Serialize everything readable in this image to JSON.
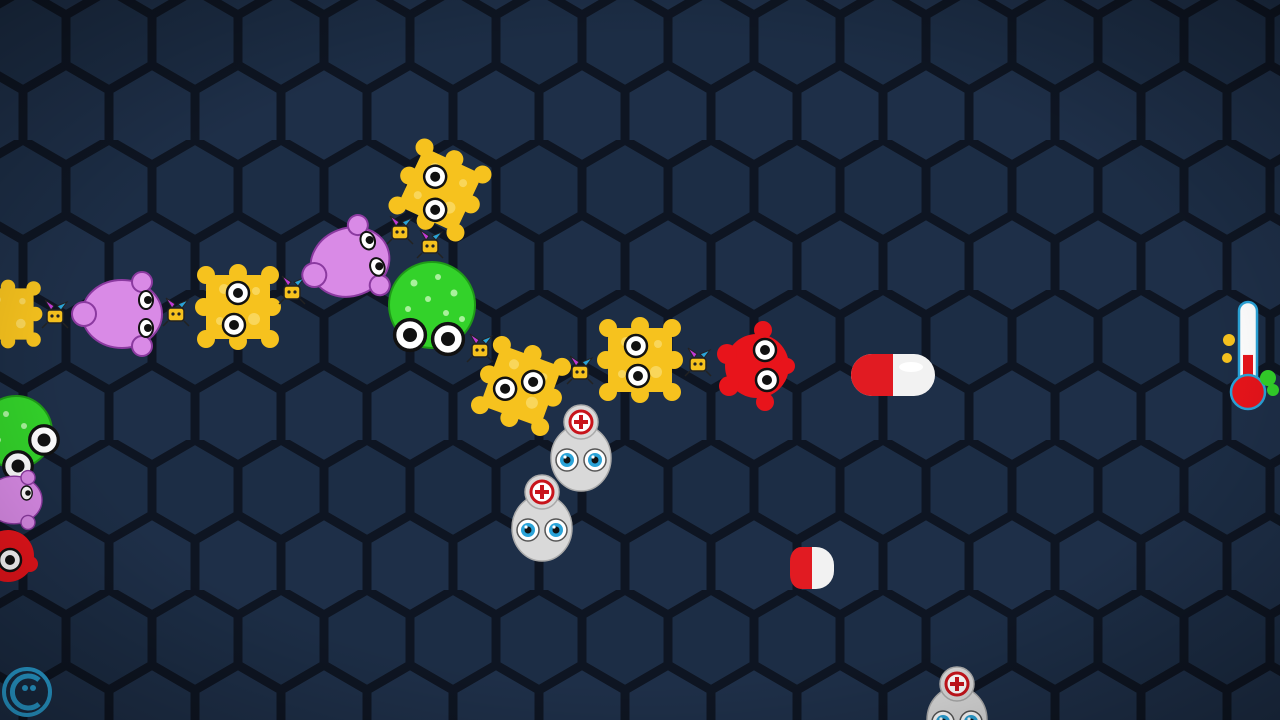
{
  "game": {
    "background_color": "#1b2b42",
    "grid_line_color": "#0e1522",
    "palette": {
      "red": "#e8141b",
      "green": "#33d22a",
      "yellow": "#f6c21e",
      "purple": "#d98ae6",
      "doctor_gray": "#d9d9d9",
      "pill_red": "#e11b22",
      "pill_white": "#f2f2f2"
    }
  },
  "hud": {
    "temperature_icon": "thermometer-icon",
    "temperature_fill_fraction": 0.45,
    "logo_icon": "game-logo-icon"
  },
  "entities": {
    "player_head": "red-germ",
    "enemy_type": "doctor-cell",
    "powerup_type": "pill-capsule",
    "creature_types": [
      "yellow-germ",
      "purple-germ",
      "green-germ",
      "red-germ",
      "tiny-bug"
    ]
  }
}
